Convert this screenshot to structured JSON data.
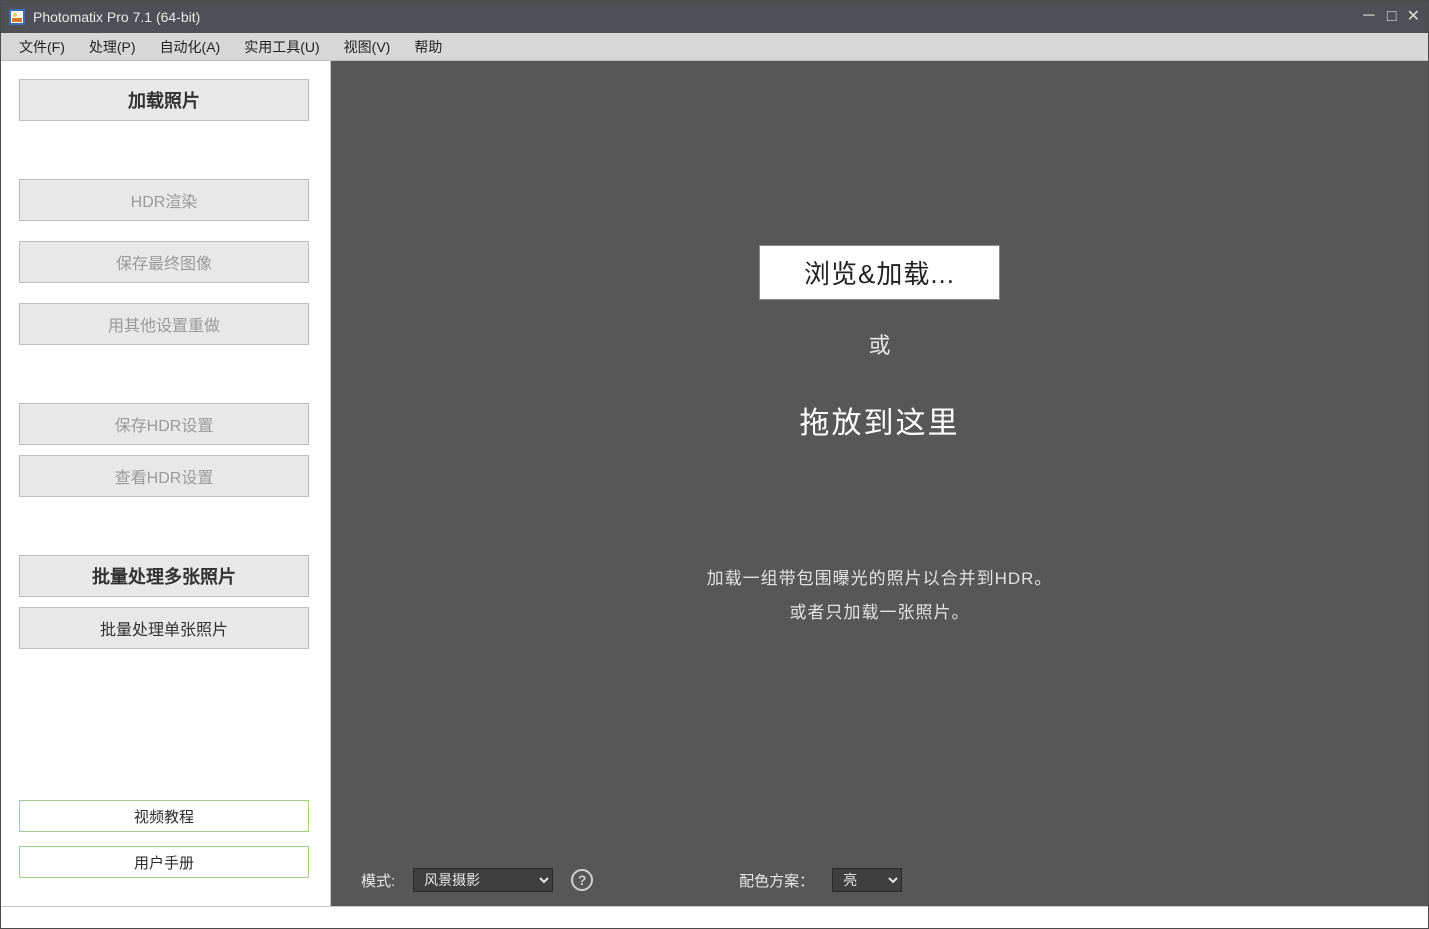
{
  "window": {
    "title": "Photomatix Pro 7.1 (64-bit)"
  },
  "menu": {
    "file": "文件(F)",
    "process": "处理(P)",
    "automation": "自动化(A)",
    "tools": "实用工具(U)",
    "view": "视图(V)",
    "help": "帮助"
  },
  "sidebar": {
    "load_photos": "加载照片",
    "hdr_render": "HDR渲染",
    "save_final": "保存最终图像",
    "redo_other": "用其他设置重做",
    "save_hdr_settings": "保存HDR设置",
    "view_hdr_settings": "查看HDR设置",
    "batch_multi": "批量处理多张照片",
    "batch_single": "批量处理单张照片",
    "video_tutorial": "视频教程",
    "user_manual": "用户手册"
  },
  "main": {
    "browse_load": "浏览&加载...",
    "or": "或",
    "drop_here": "拖放到这里",
    "hint1": "加载一组带包围曝光的照片以合并到HDR。",
    "hint2": "或者只加载一张照片。"
  },
  "bottom": {
    "mode_label": "模式:",
    "mode_value": "风景摄影",
    "scheme_label": "配色方案：",
    "scheme_value": "亮"
  }
}
